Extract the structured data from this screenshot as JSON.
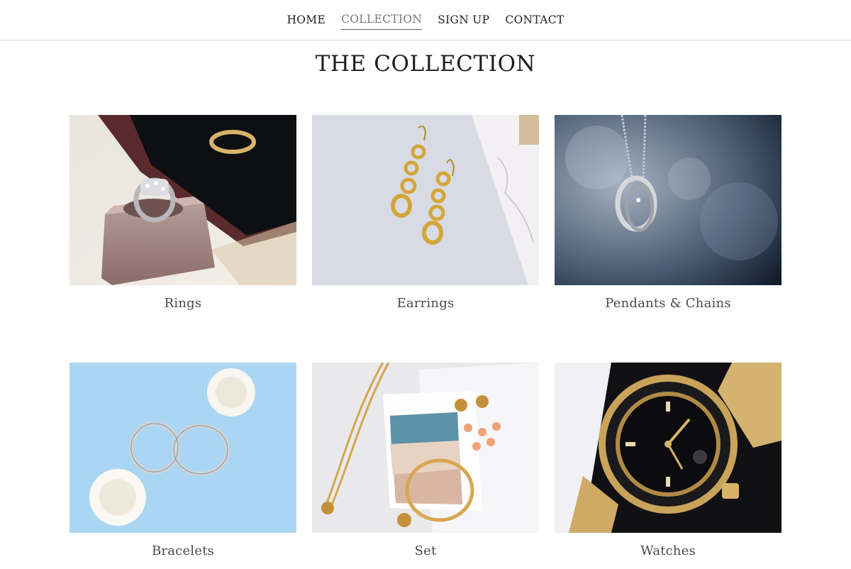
{
  "nav": {
    "items": [
      {
        "label": "HOME",
        "active": false
      },
      {
        "label": "COLLECTION",
        "active": true
      },
      {
        "label": "SIGN UP",
        "active": false
      },
      {
        "label": "CONTACT",
        "active": false
      }
    ]
  },
  "page": {
    "title": "THE COLLECTION"
  },
  "collection": {
    "items": [
      {
        "label": "Rings",
        "image": "ring-photo"
      },
      {
        "label": "Earrings",
        "image": "earrings-photo"
      },
      {
        "label": "Pendants & Chains",
        "image": "pendant-photo"
      },
      {
        "label": "Bracelets",
        "image": "bracelets-photo"
      },
      {
        "label": "Set",
        "image": "jewelry-set-photo"
      },
      {
        "label": "Watches",
        "image": "watch-photo"
      }
    ]
  },
  "colors": {
    "text": "#222222",
    "active_nav": "#777777",
    "caption": "#4a4a4a",
    "divider": "#d9d9d9"
  }
}
